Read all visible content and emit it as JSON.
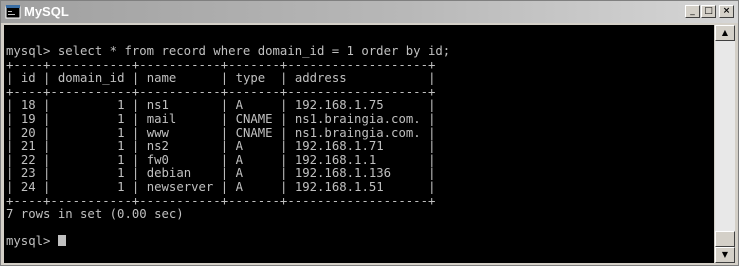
{
  "window": {
    "title": "MySQL",
    "icon": "mysql-console-icon",
    "controls": {
      "minimize_icon": "minimize-icon",
      "maximize_icon": "maximize-icon",
      "close_icon": "close-icon"
    }
  },
  "console": {
    "query_line": "mysql> select * from record where domain_id = 1 order by id;",
    "table": {
      "columns": [
        "id",
        "domain_id",
        "name",
        "type",
        "address"
      ],
      "rows": [
        [
          "18",
          "1",
          "ns1",
          "A",
          "192.168.1.75"
        ],
        [
          "19",
          "1",
          "mail",
          "CNAME",
          "ns1.braingia.com."
        ],
        [
          "20",
          "1",
          "www",
          "CNAME",
          "ns1.braingia.com."
        ],
        [
          "21",
          "1",
          "ns2",
          "A",
          "192.168.1.71"
        ],
        [
          "22",
          "1",
          "fw0",
          "A",
          "192.168.1.1"
        ],
        [
          "23",
          "1",
          "debian",
          "A",
          "192.168.1.136"
        ],
        [
          "24",
          "1",
          "newserver",
          "A",
          "192.168.1.51"
        ]
      ]
    },
    "result_line": "7 rows in set (0.00 sec)",
    "prompt": "mysql> "
  },
  "scrollbar": {
    "up_icon": "scroll-up-arrow-icon",
    "down_icon": "scroll-down-arrow-icon"
  },
  "colors": {
    "console_background": "#000000",
    "console_text": "#c0c0c0",
    "titlebar": "#a0a0a0",
    "chrome": "#d4d0c8"
  }
}
